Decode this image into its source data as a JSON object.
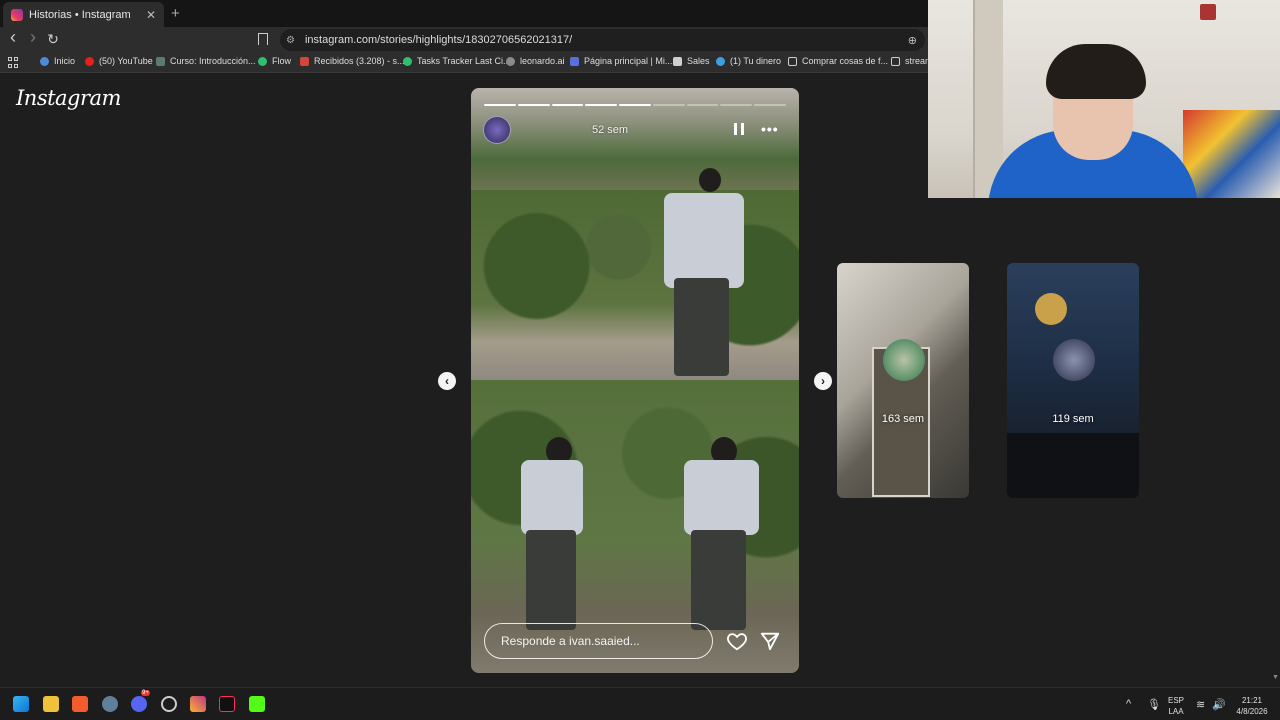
{
  "browser": {
    "tab_title": "Historias • Instagram",
    "tab_close": "✕",
    "new_tab": "+",
    "back": "‹",
    "forward": "›",
    "reload": "↻",
    "url": "instagram.com/stories/highlights/18302706562021317/",
    "zoom": "⊕",
    "bookmarks": [
      {
        "label": "Inicio",
        "color": "#4f8ad6"
      },
      {
        "label": "(50) YouTube",
        "color": "#e62117"
      },
      {
        "label": "Curso: Introducción...",
        "color": "#7c7c7c"
      },
      {
        "label": "Flow",
        "color": "#2fbf71"
      },
      {
        "label": "Recibidos (3.208) - s...",
        "color": "#d44638"
      },
      {
        "label": "Tasks Tracker Last Ci...",
        "color": "#2fbf71"
      },
      {
        "label": "leonardo.ai",
        "color": "#8a8a8a"
      },
      {
        "label": "Página principal | Mi...",
        "color": "#5a6ee0"
      },
      {
        "label": "Sales",
        "color": "#cfcfcf"
      },
      {
        "label": "(1) Tu dinero",
        "color": "#3aa0e0"
      },
      {
        "label": "Comprar cosas de f...",
        "color": "#cfcfcf"
      },
      {
        "label": "stream",
        "color": "#cfcfcf"
      }
    ]
  },
  "page": {
    "logo": "Instagram",
    "story": {
      "time": "52 sem",
      "progress_total": 9,
      "progress_done": 5,
      "reply_placeholder": "Responde a ivan.saaied...",
      "prev_glyph": "‹",
      "next_glyph": "›",
      "more_glyph": "•••"
    },
    "next_stories": [
      {
        "time": "163 sem"
      },
      {
        "time": "119 sem"
      }
    ]
  },
  "taskbar": {
    "lang_top": "ESP",
    "lang_bottom": "LAA",
    "time": "21:21",
    "date": "4/8/2026",
    "badge_discord": "9+"
  }
}
